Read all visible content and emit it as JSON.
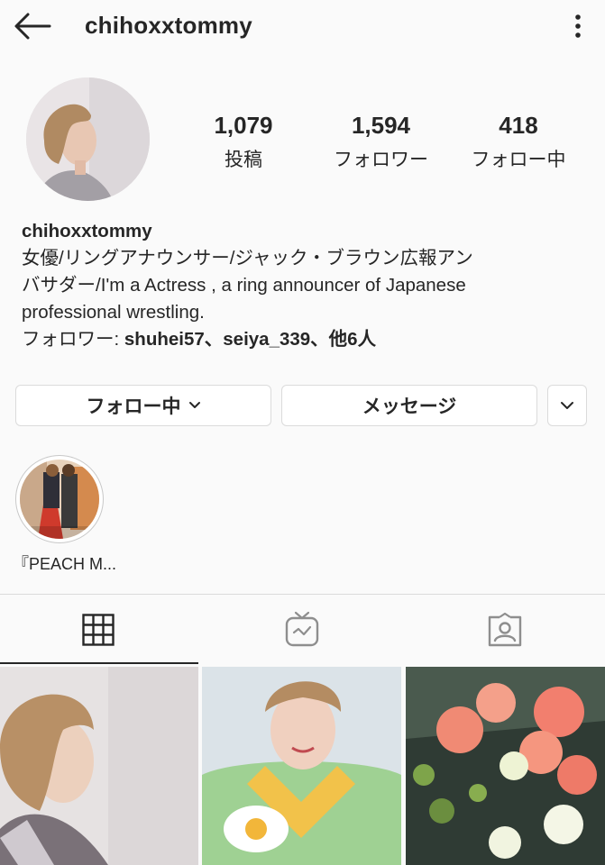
{
  "header": {
    "title": "chihoxxtommy",
    "back_icon": "arrow-left-icon",
    "more_icon": "more-vertical-icon"
  },
  "stats": [
    {
      "value": "1,079",
      "label": "投稿"
    },
    {
      "value": "1,594",
      "label": "フォロワー"
    },
    {
      "value": "418",
      "label": "フォロー中"
    }
  ],
  "bio": {
    "name": "chihoxxtommy",
    "line1": "女優/リングアナウンサー/ジャック・ブラウン広報アン",
    "line2": "バサダー/I'm a Actress , a ring announcer of Japanese",
    "line3": "professional wrestling.",
    "followed_prefix": "フォロワー: ",
    "followed_users": "shuhei57、seiya_339、他6人"
  },
  "actions": {
    "following_label": "フォロー中",
    "message_label": "メッセージ"
  },
  "highlights": [
    {
      "label": "『PEACH M..."
    }
  ],
  "tabs": [
    "grid-icon",
    "igtv-icon",
    "tagged-icon"
  ],
  "colors": {
    "text": "#262626",
    "border": "#dbdbdb",
    "background": "#fafafa"
  }
}
